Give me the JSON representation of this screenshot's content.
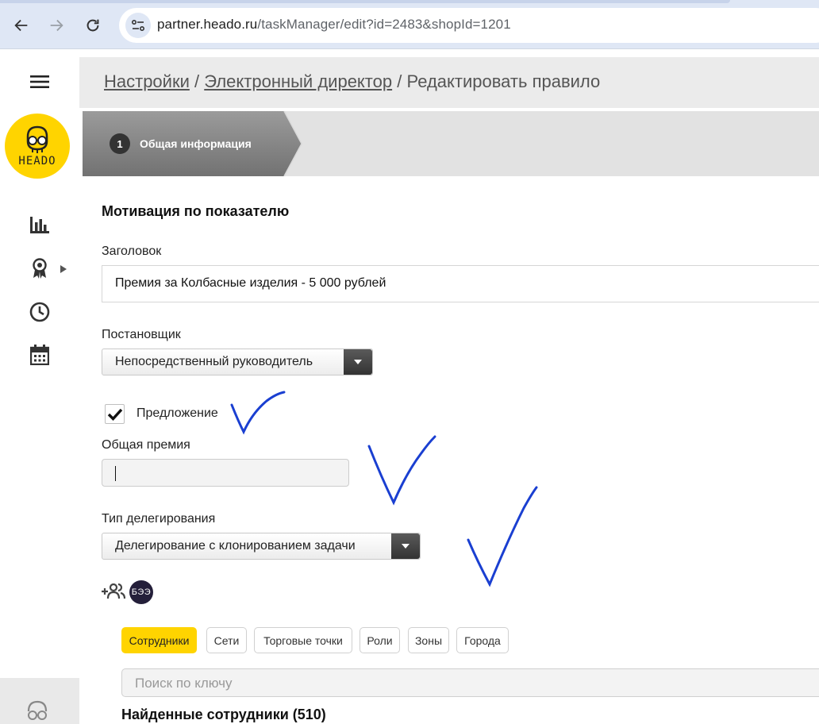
{
  "browser": {
    "url_host": "partner.heado.ru",
    "url_path": "/taskManager/edit?id=2483&shopId=1201",
    "icons": [
      "back-arrow-icon",
      "forward-arrow-icon",
      "reload-icon",
      "site-settings-icon"
    ]
  },
  "sidebar": {
    "logo_text": "HEADO",
    "icons": [
      "hamburger-menu-icon",
      "bar-chart-icon",
      "award-ribbon-icon",
      "clock-icon",
      "calendar-icon",
      "heado-glasses-icon"
    ]
  },
  "breadcrumb": {
    "items": [
      "Настройки",
      "Электронный директор"
    ],
    "current": "Редактировать правило",
    "separator": "/"
  },
  "stepper": {
    "step_number": "1",
    "step_label": "Общая информация"
  },
  "form": {
    "section_title": "Мотивация по показателю",
    "title_label": "Заголовок",
    "title_value": "Премия за Колбасные изделия - 5 000 рублей",
    "assigner_label": "Постановщик",
    "assigner_value": "Непосредственный руководитель",
    "proposal_label": "Предложение",
    "proposal_checked": true,
    "bonus_label": "Общая премия",
    "bonus_value": "",
    "delegation_label": "Тип делегирования",
    "delegation_value": "Делегирование с клонированием задачи",
    "avatar_initials": "БЭЭ"
  },
  "filter_tabs": [
    {
      "label": "Сотрудники",
      "active": true
    },
    {
      "label": "Сети",
      "active": false
    },
    {
      "label": "Торговые точки",
      "active": false
    },
    {
      "label": "Роли",
      "active": false
    },
    {
      "label": "Зоны",
      "active": false
    },
    {
      "label": "Города",
      "active": false
    }
  ],
  "search": {
    "placeholder": "Поиск по ключу"
  },
  "results": {
    "title": "Найденные сотрудники (510)"
  },
  "colors": {
    "accent": "#ffd400",
    "annotation": "#1a3fd1",
    "stepper_active": "#8a8a8a"
  }
}
